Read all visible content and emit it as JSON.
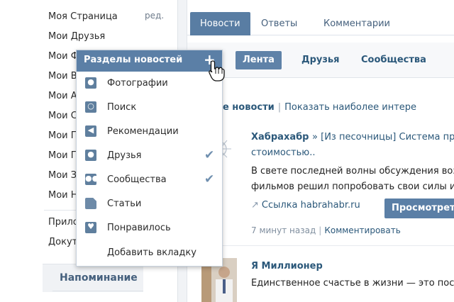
{
  "sidebar": {
    "edit_label": "ред.",
    "items": [
      {
        "label": "Моя Страница"
      },
      {
        "label": "Мои Друзья"
      },
      {
        "label": "Мои Ф"
      },
      {
        "label": "Мои В"
      },
      {
        "label": "Мои А"
      },
      {
        "label": "Мои С"
      },
      {
        "label": "Мои П"
      },
      {
        "label": "Мои Г"
      },
      {
        "label": "Мои З"
      },
      {
        "label": "Мои Н"
      },
      {
        "label": "Прило"
      },
      {
        "label": "Докут"
      }
    ],
    "reminder_label": "Напоминание"
  },
  "tabs": [
    {
      "label": "Новости"
    },
    {
      "label": "Ответы"
    },
    {
      "label": "Комментарии"
    }
  ],
  "subtabs": [
    {
      "label": "Лента"
    },
    {
      "label": "Друзья"
    },
    {
      "label": "Сообщества"
    }
  ],
  "filter": {
    "current": "аны все новости",
    "option": "Показать наиболее интере"
  },
  "posts": [
    {
      "author": "Хабрахабр",
      "crumb": "» [Из песочницы] Система пр",
      "title_cont": "стоимостью..",
      "text_lines": [
        "В свете последней волны обсуждения воз",
        "фильмов решил попробовать свои силы и"
      ],
      "link_label": "Ссылка habrahabr.ru",
      "button_label": "Просмотреть",
      "time": "7 минут назад",
      "action": "Комментировать"
    },
    {
      "author": "Я Миллионер",
      "text_lines": [
        "Единственное счастье в жизни — это пос"
      ]
    }
  ],
  "dropdown": {
    "title": "Разделы новостей",
    "items": [
      {
        "label": "Фотографии",
        "icon": "camera-icon",
        "checked": false
      },
      {
        "label": "Поиск",
        "icon": "search-icon",
        "checked": false
      },
      {
        "label": "Рекомендации",
        "icon": "megaphone-icon",
        "checked": false
      },
      {
        "label": "Друзья",
        "icon": "user-icon",
        "checked": true
      },
      {
        "label": "Сообщества",
        "icon": "group-icon",
        "checked": true
      },
      {
        "label": "Статьи",
        "icon": "document-icon",
        "checked": false
      },
      {
        "label": "Понравилось",
        "icon": "heart-icon",
        "checked": false
      }
    ],
    "add_tab_label": "Добавить вкладку"
  },
  "colors": {
    "accent": "#597da3",
    "link": "#2b587a",
    "header_bg": "#5b7fa6"
  }
}
